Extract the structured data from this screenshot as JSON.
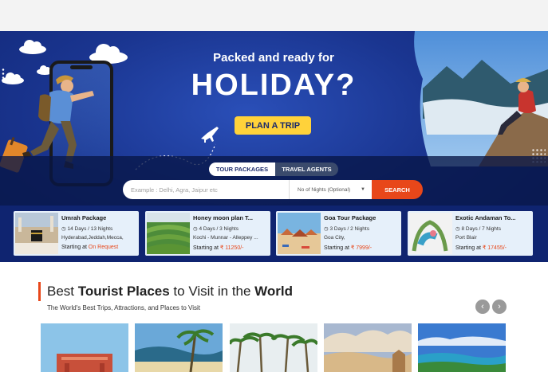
{
  "hero": {
    "headline_small": "Packed and ready for",
    "headline_big": "HOLIDAY?",
    "plan_button": "PLAN A TRIP"
  },
  "search": {
    "tabs": [
      "TOUR PACKAGES",
      "TRAVEL AGENTS"
    ],
    "active_tab": "TOUR PACKAGES",
    "placeholder": "Example : Delhi, Agra, Jaipur etc",
    "nights_label": "No of Nights (Optional)",
    "search_button": "SEARCH"
  },
  "packages": [
    {
      "title": "Umrah Package",
      "duration": "14 Days / 13 Nights",
      "places": "Hyderabad,Jeddah,Mecca,",
      "price_prefix": "Starting at",
      "price": "On Request"
    },
    {
      "title": "Honey moon plan T...",
      "duration": "4 Days / 3 Nights",
      "places": "Kochi - Munnar - Alleppey ...",
      "price_prefix": "Starting at",
      "price": "₹ 11250/-"
    },
    {
      "title": "Goa Tour Package",
      "duration": "3 Days / 2 Nights",
      "places": "Goa City,",
      "price_prefix": "Starting at",
      "price": "₹ 7999/-"
    },
    {
      "title": "Exotic Andaman To...",
      "duration": "8 Days / 7 Nights",
      "places": "Port Blair",
      "price_prefix": "Starting at",
      "price": "₹ 17455/-"
    }
  ],
  "section": {
    "title_part1": "Best ",
    "title_bold1": "Tourist Places",
    "title_part2": " to Visit in the ",
    "title_bold2": "World",
    "subtitle": "The World's Best Trips, Attractions, and Places to Visit"
  },
  "icons": {
    "clock": "clock-icon",
    "caret": "caret-down-icon",
    "prev": "chevron-left-icon",
    "next": "chevron-right-icon"
  },
  "colors": {
    "hero_blue": "#1a3590",
    "accent_orange": "#e8471a",
    "plan_yellow": "#ffd23a",
    "card_bg": "#e6f0fa"
  }
}
